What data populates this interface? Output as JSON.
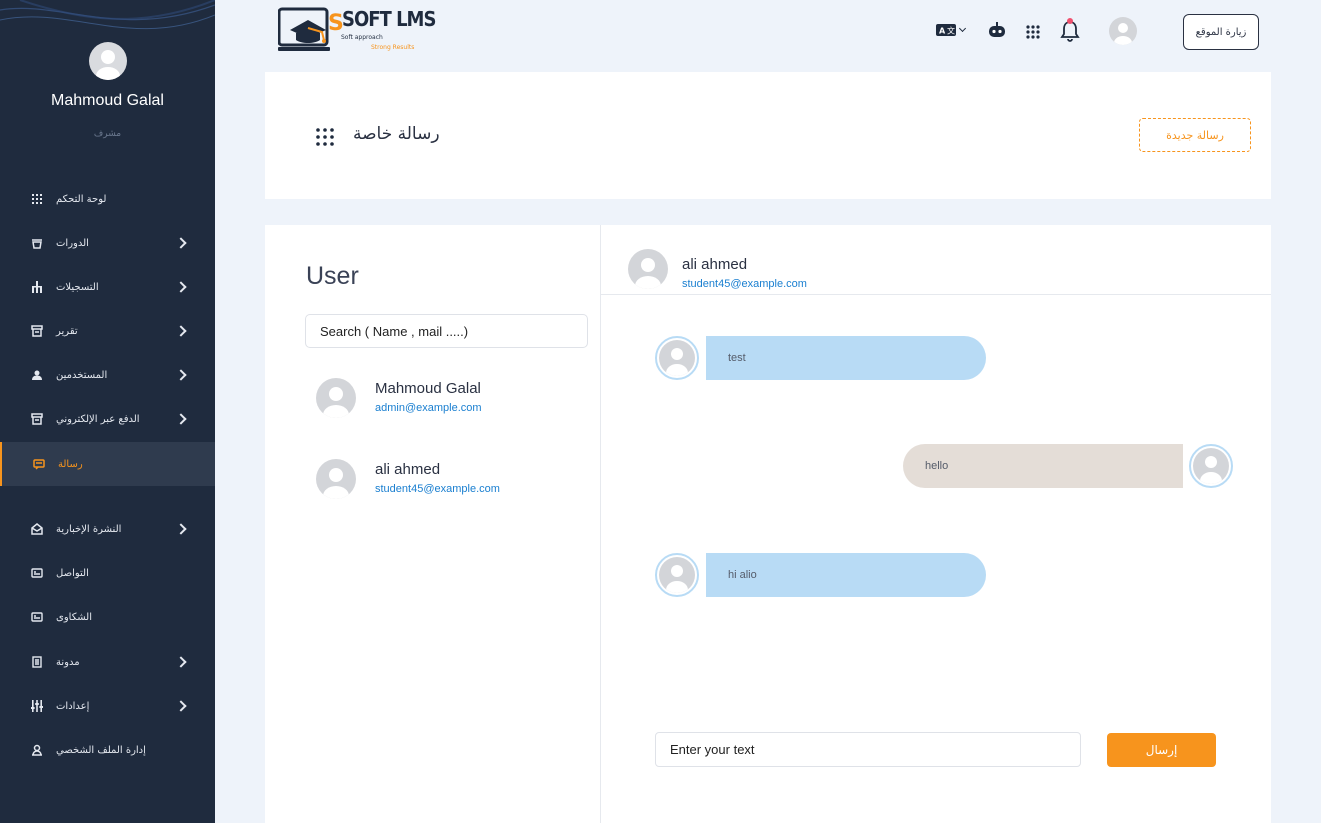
{
  "sidebar": {
    "user_name": "Mahmoud Galal",
    "user_role": "مشرف",
    "items": [
      {
        "label": "لوحة التحكم",
        "icon": "grid-icon",
        "chevron": false
      },
      {
        "label": "الدورات",
        "icon": "courses-icon",
        "chevron": true
      },
      {
        "label": "التسجيلات",
        "icon": "hierarchy-icon",
        "chevron": true
      },
      {
        "label": "تقرير",
        "icon": "archive-icon",
        "chevron": true
      },
      {
        "label": "المستخدمين",
        "icon": "users-icon",
        "chevron": true
      },
      {
        "label": "الدفع عبر الإلكتروني",
        "icon": "payment-icon",
        "chevron": true
      },
      {
        "label": "رسالة",
        "icon": "message-icon",
        "chevron": false,
        "active": true
      },
      {
        "label": "النشرة الإخبارية",
        "icon": "newsletter-icon",
        "chevron": true
      },
      {
        "label": "التواصل",
        "icon": "contact-icon",
        "chevron": false
      },
      {
        "label": "الشكاوى",
        "icon": "complaints-icon",
        "chevron": false
      },
      {
        "label": "مدونة",
        "icon": "blog-icon",
        "chevron": true
      },
      {
        "label": "إعدادات",
        "icon": "settings-sliders-icon",
        "chevron": true
      },
      {
        "label": "إدارة الملف الشخصي",
        "icon": "profile-icon",
        "chevron": false
      }
    ]
  },
  "header": {
    "logo_text": "SOFT LMS",
    "logo_tagline_1": "Soft approach",
    "logo_tagline_2": "Strong Results",
    "visit_site": "زيارة الموقع"
  },
  "page": {
    "title": "رسالة خاصة",
    "new_message_button": "رسالة جديدة"
  },
  "users_panel": {
    "title": "User",
    "search_placeholder": "Search ( Name , mail .....)",
    "users": [
      {
        "name": "Mahmoud Galal",
        "email": "admin@example.com"
      },
      {
        "name": "ali ahmed",
        "email": "student45@example.com"
      }
    ]
  },
  "chat": {
    "contact_name": "ali ahmed",
    "contact_email": "student45@example.com",
    "messages": [
      {
        "text": "test",
        "direction": "in"
      },
      {
        "text": "hello",
        "direction": "out"
      },
      {
        "text": "hi alio",
        "direction": "in"
      }
    ],
    "input_placeholder": "Enter your text",
    "send_button": "إرسال"
  },
  "colors": {
    "sidebar_bg": "#1f2b3e",
    "accent": "#f7941d",
    "link": "#1a7fd0",
    "incoming_bubble": "#b8dbf5",
    "outgoing_bubble": "#e4ddd7"
  }
}
